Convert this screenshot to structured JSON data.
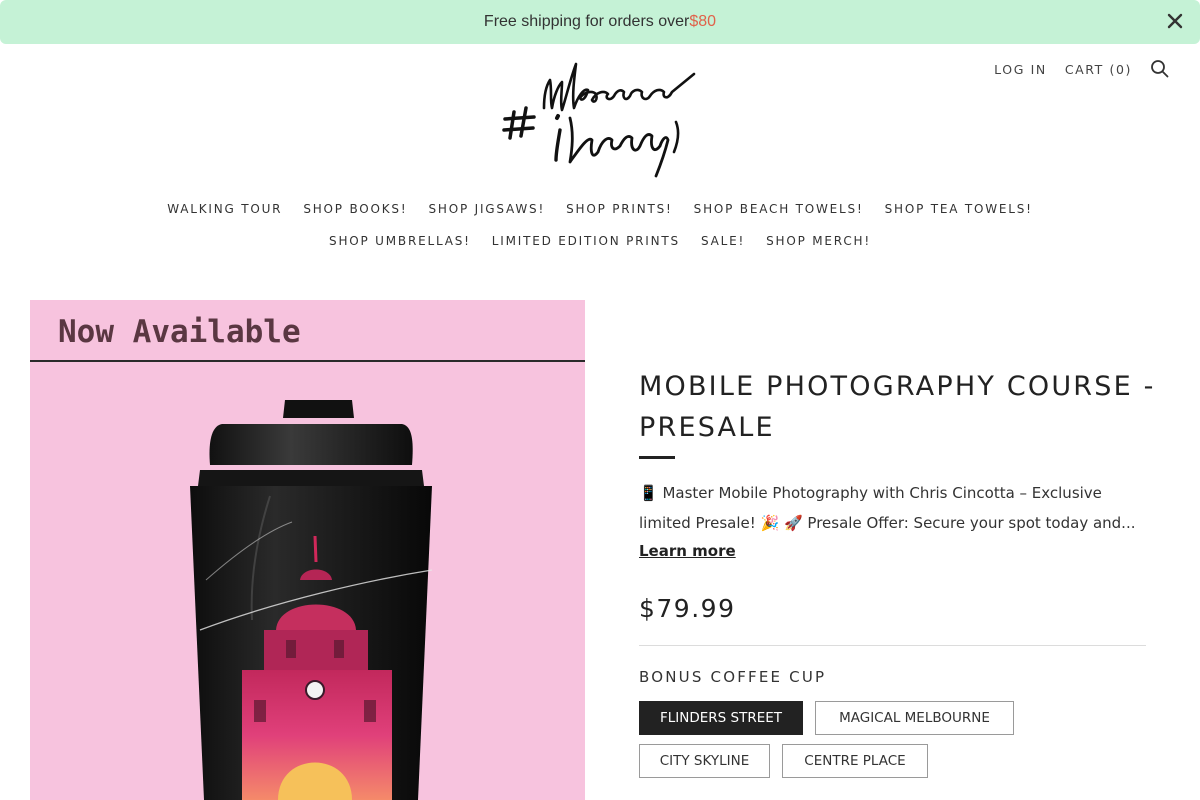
{
  "announcement": {
    "text": "Free shipping for orders over ",
    "amount": "$80"
  },
  "header": {
    "login": "LOG IN",
    "cart": "CART (0)"
  },
  "nav": {
    "row1": [
      "WALKING TOUR",
      "SHOP BOOKS!",
      "SHOP JIGSAWS!",
      "SHOP PRINTS!",
      "SHOP BEACH TOWELS!",
      "SHOP TEA TOWELS!"
    ],
    "row2": [
      "SHOP UMBRELLAS!",
      "LIMITED EDITION PRINTS",
      "SALE!",
      "SHOP MERCH!"
    ]
  },
  "product": {
    "image_caption": "Now Available",
    "title": "MOBILE PHOTOGRAPHY COURSE - PRESALE",
    "description": "📱 Master Mobile Photography with Chris Cincotta – Exclusive limited Presale! 🎉 🚀 Presale Offer: Secure your spot today and...",
    "learn_more": "Learn more",
    "price": "$79.99",
    "option_label": "BONUS COFFEE CUP",
    "options": [
      {
        "label": "FLINDERS STREET",
        "selected": true
      },
      {
        "label": "MAGICAL MELBOURNE",
        "selected": false
      },
      {
        "label": "CITY SKYLINE",
        "selected": false
      },
      {
        "label": "CENTRE PLACE",
        "selected": false
      }
    ]
  },
  "colors": {
    "announcement_bg": "#c5f2d6",
    "price_accent": "#e0624a",
    "image_bg": "#f7c3de",
    "selected_option": "#222222"
  }
}
